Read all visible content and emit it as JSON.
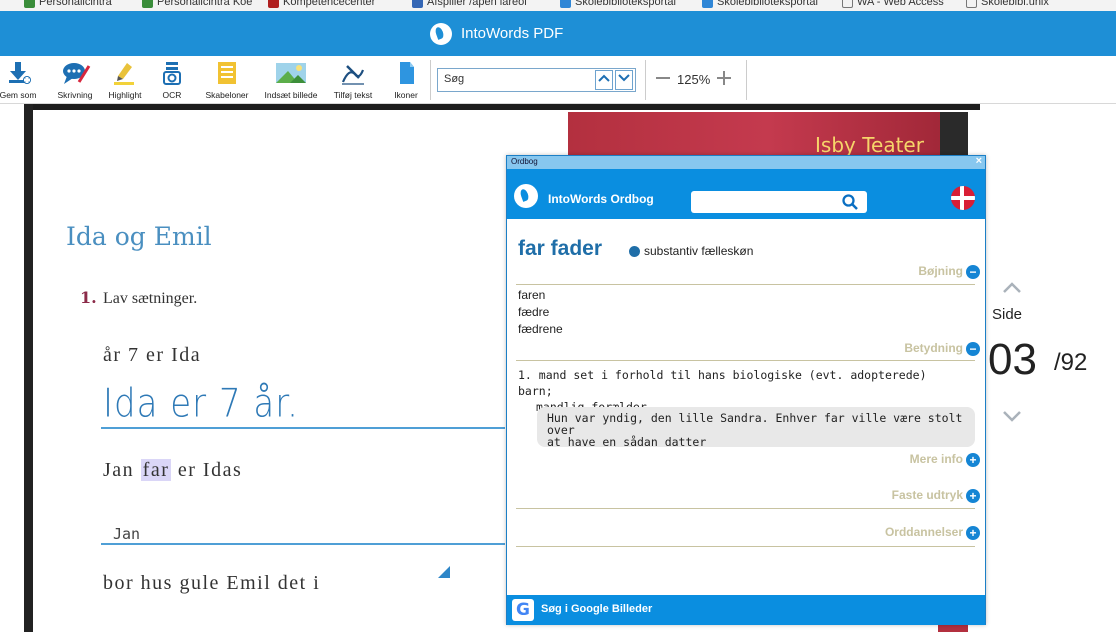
{
  "bookmarks": [
    "Personalicintra",
    "Personalicintra Koe",
    "Kompetencecenter",
    "Afspiller /apen lareol",
    "Skolebiblioteksportal",
    "Skolebiblioteksportal",
    "WA - Web Access",
    "Skolebibl.unix"
  ],
  "app": {
    "title": "IntoWords PDF"
  },
  "toolbar": {
    "tools": [
      "Gem som",
      "Skrivning",
      "Highlight",
      "OCR",
      "Skabeloner",
      "Indsæt billede",
      "Tilføj tekst",
      "Ikoner"
    ],
    "search_value": "Søg",
    "zoom_label": "125%"
  },
  "document": {
    "banner": "Isby Teater",
    "heading": "Ida og Emil",
    "exercise_number": "1.",
    "exercise_text": "Lav sætninger.",
    "words1": "år  7  er  Ida",
    "handwritten": "Ida er 7 år.",
    "words2_before": "Jan",
    "words2_highlight": "far",
    "words2_after": "er  Idas",
    "typed_answer": "Jan",
    "words3": "bor  hus  gule  Emil  det  i"
  },
  "navigation": {
    "side_label": "Side",
    "current_page": "03",
    "total_pages": "/92"
  },
  "dictionary": {
    "caption": "Ordbog",
    "title": "IntoWords Ordbog",
    "headword": "far fader",
    "word_class": "substantiv fælleskøn",
    "sections": {
      "inflection": "Bøjning",
      "meaning": "Betydning",
      "more_info": "Mere info",
      "fixed_expressions": "Faste udtryk",
      "word_formations": "Orddannelser"
    },
    "forms": [
      "faren",
      "fædre",
      "fædrene"
    ],
    "meaning_1": "1. mand set i forhold til hans biologiske (evt. adopterede) barn;",
    "meaning_2": "mandlig forælder",
    "example_1": "Hun var yndig, den lille Sandra. Enhver far ville være stolt over",
    "example_2": "at have en sådan datter",
    "google_label": "Søg i Google Billeder"
  },
  "colors": {
    "accent": "#1e8fd6",
    "dict_header": "#0a8ee0",
    "headword": "#1f6ea8"
  },
  "icons": [
    "save-icon",
    "speech-icon",
    "pen-icon",
    "ocr-icon",
    "template-icon",
    "image-icon",
    "text-sign-icon",
    "file-icon",
    "search-icon",
    "danish-flag-icon",
    "google-icon"
  ]
}
